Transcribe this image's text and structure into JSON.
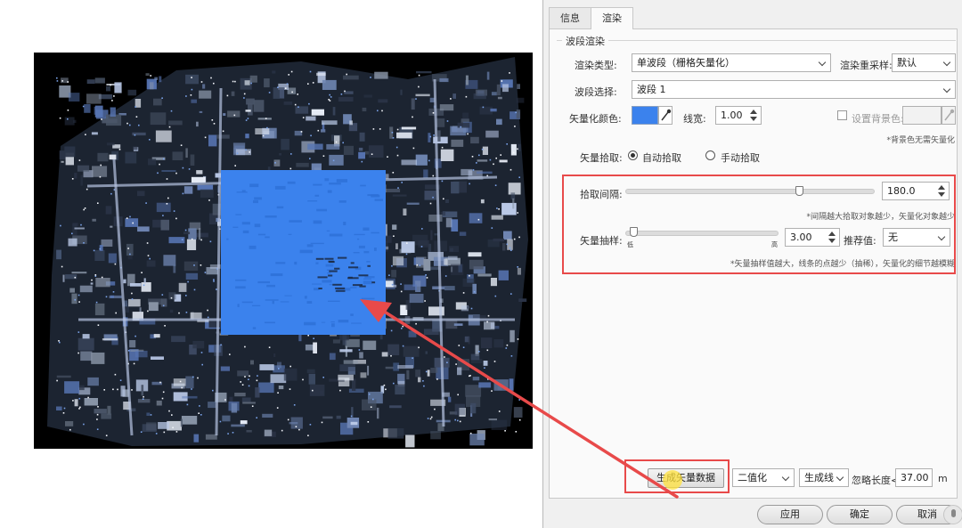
{
  "tabs": [
    "信息",
    "渲染"
  ],
  "group_title": "波段渲染",
  "render_type": {
    "label": "渲染类型:",
    "value": "单波段（栅格矢量化）"
  },
  "resample": {
    "label": "渲染重采样:",
    "value": "默认"
  },
  "band": {
    "label": "波段选择:",
    "value": "波段 1"
  },
  "vector_color": {
    "label": "矢量化颜色:",
    "color": "#3b82ed"
  },
  "line_width": {
    "label": "线宽:",
    "value": "1.00"
  },
  "bg_color": {
    "label": "设置背景色:",
    "checked": false
  },
  "bg_note": "*背景色无需矢量化",
  "pickup": {
    "label": "矢量拾取:",
    "auto": "自动拾取",
    "manual": "手动拾取",
    "selected": "auto"
  },
  "interval": {
    "label": "拾取间隔:",
    "value": "180.0",
    "note": "*间隔越大拾取对象越少，矢量化对象越少"
  },
  "sampling": {
    "label": "矢量抽样:",
    "value": "3.00",
    "low": "低",
    "high": "高",
    "recommend_label": "推荐值:",
    "recommend_value": "无",
    "note": "*矢量抽样值越大，线条的点越少（抽稀），矢量化的细节越模糊"
  },
  "generate_button": "生成矢量数据",
  "mode_select": "二值化",
  "output_select": "生成线",
  "ignore_label": "忽略长度<",
  "ignore_value": "37.00",
  "ignore_unit": "m",
  "footer": {
    "apply": "应用",
    "ok": "确定",
    "cancel": "取消"
  },
  "colors": {
    "annotation": "#e84a4a",
    "vector_fill": "#3b82ed",
    "map_background": "#000000"
  }
}
